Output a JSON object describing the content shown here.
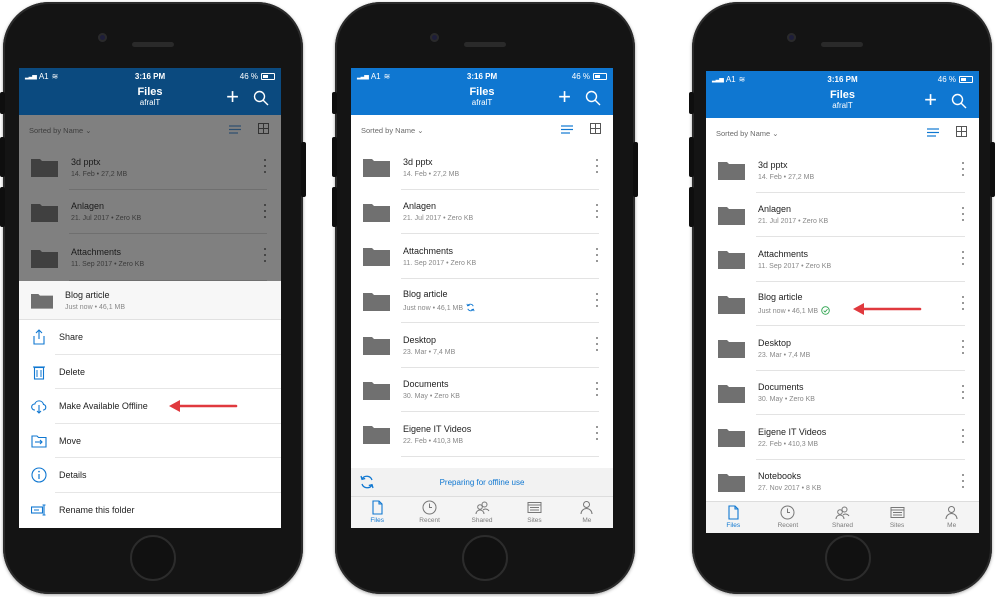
{
  "colors": {
    "accent": "#0f77d1",
    "dimmed_header": "#0b4a7f",
    "arrow": "#e0393e"
  },
  "status": {
    "carrier": "A1",
    "time": "3:16 PM",
    "battery": "46 %"
  },
  "app": {
    "title": "Files",
    "subtitle": "afralT"
  },
  "sort_label": "Sorted by Name",
  "phone1": {
    "files": [
      {
        "name": "3d pptx",
        "meta": "14. Feb • 27,2 MB"
      },
      {
        "name": "Anlagen",
        "meta": "21. Jul 2017 • Zero KB"
      },
      {
        "name": "Attachments",
        "meta": "11. Sep 2017 • Zero KB"
      }
    ],
    "selected": {
      "name": "Blog article",
      "meta": "Just now • 46,1 MB"
    },
    "actions": [
      {
        "label": "Share",
        "icon": "share-icon"
      },
      {
        "label": "Delete",
        "icon": "trash-icon"
      },
      {
        "label": "Make Available Offline",
        "icon": "cloud-download-icon"
      },
      {
        "label": "Move",
        "icon": "move-icon"
      },
      {
        "label": "Details",
        "icon": "info-icon"
      },
      {
        "label": "Rename this folder",
        "icon": "rename-icon"
      }
    ]
  },
  "phone2": {
    "files": [
      {
        "name": "3d pptx",
        "meta": "14. Feb • 27,2 MB"
      },
      {
        "name": "Anlagen",
        "meta": "21. Jul 2017 • Zero KB"
      },
      {
        "name": "Attachments",
        "meta": "11. Sep 2017 • Zero KB"
      },
      {
        "name": "Blog article",
        "meta": "Just now • 46,1 MB"
      },
      {
        "name": "Desktop",
        "meta": "23. Mar • 7,4 MB"
      },
      {
        "name": "Documents",
        "meta": "30. May • Zero KB"
      },
      {
        "name": "Eigene IT Videos",
        "meta": "22. Feb • 410,3 MB"
      }
    ],
    "preparing": "Preparing for offline use"
  },
  "phone3": {
    "files": [
      {
        "name": "3d pptx",
        "meta": "14. Feb • 27,2 MB"
      },
      {
        "name": "Anlagen",
        "meta": "21. Jul 2017 • Zero KB"
      },
      {
        "name": "Attachments",
        "meta": "11. Sep 2017 • Zero KB"
      },
      {
        "name": "Blog article",
        "meta": "Just now • 46,1 MB"
      },
      {
        "name": "Desktop",
        "meta": "23. Mar • 7,4 MB"
      },
      {
        "name": "Documents",
        "meta": "30. May • Zero KB"
      },
      {
        "name": "Eigene IT Videos",
        "meta": "22. Feb • 410,3 MB"
      },
      {
        "name": "Notebooks",
        "meta": "27. Nov 2017 • 8 KB"
      }
    ]
  },
  "tabs": [
    {
      "label": "Files",
      "icon": "file-icon"
    },
    {
      "label": "Recent",
      "icon": "clock-icon"
    },
    {
      "label": "Shared",
      "icon": "people-icon"
    },
    {
      "label": "Sites",
      "icon": "sites-icon"
    },
    {
      "label": "Me",
      "icon": "person-icon"
    }
  ]
}
